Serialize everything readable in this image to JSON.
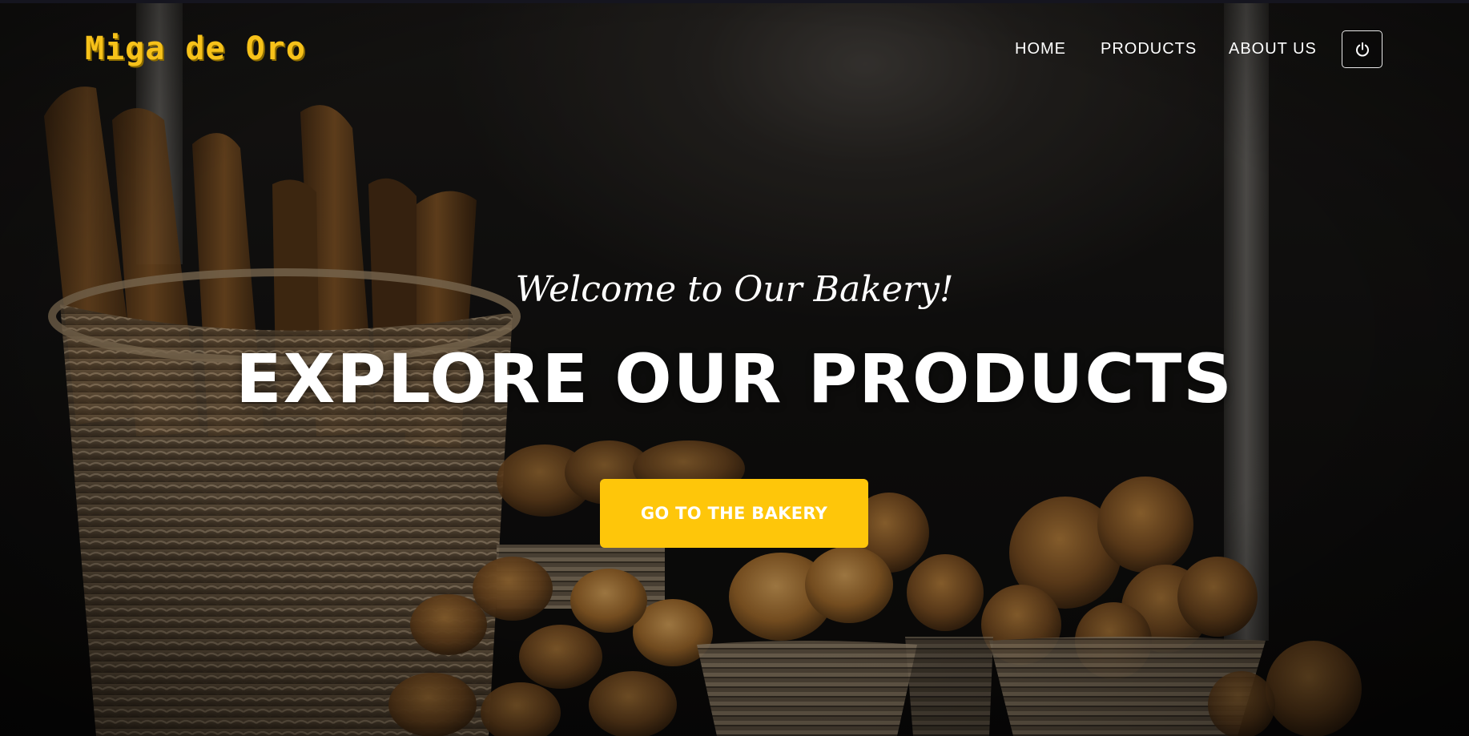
{
  "navbar": {
    "brand": "Miga de Oro",
    "links": [
      {
        "label": "HOME"
      },
      {
        "label": "PRODUCTS"
      },
      {
        "label": "ABOUT US"
      }
    ],
    "power_icon": "power-icon"
  },
  "hero": {
    "welcome": "Welcome to Our Bakery!",
    "headline": "EXPLORE OUR PRODUCTS",
    "cta_label": "GO TO THE BAKERY",
    "background_image": "bread-baskets-photo"
  },
  "colors": {
    "brand": "#f7c21a",
    "accent": "#fec60a",
    "text": "#ffffff",
    "background": "#121110"
  }
}
